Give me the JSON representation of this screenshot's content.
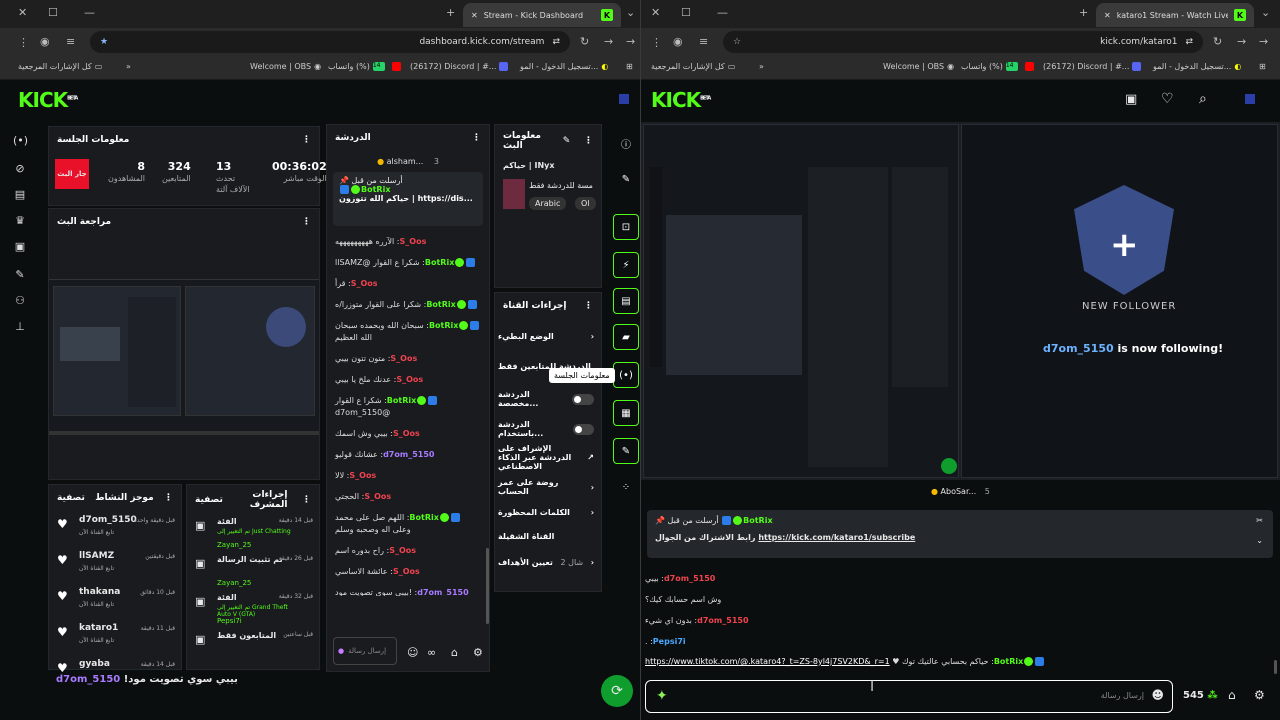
{
  "left": {
    "tab_title": "Stream - Kick Dashboard",
    "url": "dashboard.kick.com/stream",
    "bookmarks": {
      "all": "كل الإشارات المرجعية",
      "obs": "Welcome | OBS",
      "whatsapp": "واتساب (%)",
      "whatsapp_count": "14",
      "discord": "(26172) Discord | #...",
      "login": "تسجيل الدخول - المو..."
    },
    "logo": "KICK",
    "logo_sup": "BETA",
    "session": {
      "title": "معلومات الجلسة",
      "live_badge": "جار البث",
      "viewers": "8",
      "viewers_label": "المشاهدون",
      "followers": "324",
      "followers_label": "المتابعين",
      "chat": "13",
      "chat_label": "تحدث الآلاف آلتة",
      "time": "00:36:02",
      "time_label": "الوقت مباشر"
    },
    "review_title": "مراجعة البث",
    "chat": {
      "title": "الدردشة",
      "top_user": "alsham...",
      "top_count": "3",
      "pinned_label": "أرسلت من قبل",
      "pinned_user": "BotRix",
      "pinned_text": "حياكم الله تتوزون | https://dis...",
      "messages": [
        {
          "user": "S_Oos",
          "cls": "red",
          "text": "الآرره هههههههههه"
        },
        {
          "user": "BotRix",
          "cls": "green",
          "text": "شكرا ع القوار @llSAMZ",
          "badges": true
        },
        {
          "user": "S_Oos",
          "cls": "red",
          "text": "قرأ"
        },
        {
          "user": "BotRix",
          "cls": "green",
          "text": "شكرا على القوار متوزرا/ه",
          "badges": true
        },
        {
          "user": "BotRix",
          "cls": "green",
          "text": "سبحان الله وبحمده سبحان الله العظيم",
          "badges": true
        },
        {
          "user": "S_Oos",
          "cls": "red",
          "text": "متون تتون بيبي"
        },
        {
          "user": "S_Oos",
          "cls": "red",
          "text": "عدنك ملخ يا بيبي"
        },
        {
          "user": "BotRix",
          "cls": "green",
          "text": "شكرا ع القوار @d7om_5150",
          "badges": true
        },
        {
          "user": "S_Oos",
          "cls": "red",
          "text": "بيبي وش اسمك"
        },
        {
          "user": "d7om_5150",
          "cls": "purple",
          "text": "عشانك قوليو"
        },
        {
          "user": "S_Oos",
          "cls": "red",
          "text": "لالا"
        },
        {
          "user": "S_Oos",
          "cls": "red",
          "text": "الحجتي"
        },
        {
          "user": "BotRix",
          "cls": "green",
          "text": "اللهم صل على محمد وعلى اله وصحبه وسلم",
          "badges": true
        },
        {
          "user": "S_Oos",
          "cls": "red",
          "text": "راح بدوره اسم"
        },
        {
          "user": "S_Oos",
          "cls": "red",
          "text": "عائشة الاساسي"
        },
        {
          "user": "d7om_5150",
          "cls": "purple",
          "text": "!بيبي سوي تصويت مود"
        }
      ],
      "input_placeholder": "إرسال رسالة"
    },
    "stream_info": {
      "title": "معلومات البث",
      "stream_title": "حياكم | INyx",
      "category": "مسة للدردشة فقط",
      "lang": "Arabic",
      "lang2": "Ol"
    },
    "mod_actions": {
      "title": "إجراءات القناة",
      "items": [
        "الوضع البطيء",
        "الدردشة للمتابعين فقط",
        "الدردشة مخصصة...",
        "الدردشة باستخدام...",
        "الإشراف على الدردشة عبر الذكاء الاصطناعي",
        "روضة على عمر الحساب",
        "الكلمات المحظورة",
        "القناة الشقيلة",
        "تعيين الأهداف"
      ],
      "goal_count": "2 شال"
    },
    "tooltip": "معلومات الجلسة",
    "activity": {
      "title": "موجز النشاط",
      "filter": "تصفية",
      "items": [
        {
          "user": "d7om_5150",
          "time": "قبل دقيقة واحدة",
          "sub": "تابع القناة الآن"
        },
        {
          "user": "llSAMZ",
          "time": "قبل دقيقتين",
          "sub": "تابع القناة الآن"
        },
        {
          "user": "thakana",
          "time": "قبل 10 دقائق",
          "sub": "تابع القناة الآن"
        },
        {
          "user": "kataro1",
          "time": "قبل 11 دقيقة",
          "sub": "تابع القناة الآن"
        },
        {
          "user": "gyaba",
          "time": "قبل 14 دقيقة",
          "sub": ""
        }
      ]
    },
    "mod_log": {
      "title": "إجراءات المشرف",
      "filter": "تصفية",
      "items": [
        {
          "label": "الفئة",
          "time": "قبل 14 دقيقة",
          "detail": "تم التغيير إلى Just Chatting",
          "by": "Zayan_25"
        },
        {
          "label": "تم تثبيت الرسالة",
          "time": "قبل 26 دقيقة",
          "detail": "",
          "by": "Zayan_25"
        },
        {
          "label": "الفئة",
          "time": "قبل 32 دقيقة",
          "detail": "تم التغيير إلى Grand Theft Auto V (GTA)",
          "by": "Pepsi7i"
        },
        {
          "label": "المتابعون فقط",
          "time": "قبل ساعتين",
          "detail": "",
          "by": ""
        }
      ]
    },
    "overlay_user": "d7om_5150",
    "overlay_text": "!بيبي سوي تصويت مود"
  },
  "right": {
    "tab_title": "kataro1 Stream - Watch Live on...",
    "url": "kick.com/kataro1",
    "logo": "KICK",
    "notif_user": "d7om_5150",
    "notif_text": "is now following!",
    "new_follower": "NEW FOLLOWER",
    "top_user": "AboSar...",
    "top_count": "5",
    "pinned_label": "أرسلت من قبل",
    "pinned_user": "BotRix",
    "pinned_text": "رابط الاشتراك من الجوال",
    "pinned_link": "https://kick.com/kataro1/subscribe",
    "messages": [
      {
        "user": "d7om_5150",
        "cls": "red",
        "text": "بيبي"
      },
      {
        "user": "",
        "cls": "",
        "text": "وش اسم حسابك كيك؟"
      },
      {
        "user": "d7om_5150",
        "cls": "red",
        "text": "بدون اي شيء"
      },
      {
        "user": "Pepsi7i",
        "cls": "blue",
        "text": "."
      }
    ],
    "last_user": "BotRix",
    "last_text": "حياكم بحسابي عالتيك توك ♥",
    "last_link": "https://www.tiktok.com/@.katarо4?_t=ZS-8yl4j7SV2KD&_r=1",
    "send_placeholder": "إرسال رسالة",
    "kicks": "545"
  }
}
